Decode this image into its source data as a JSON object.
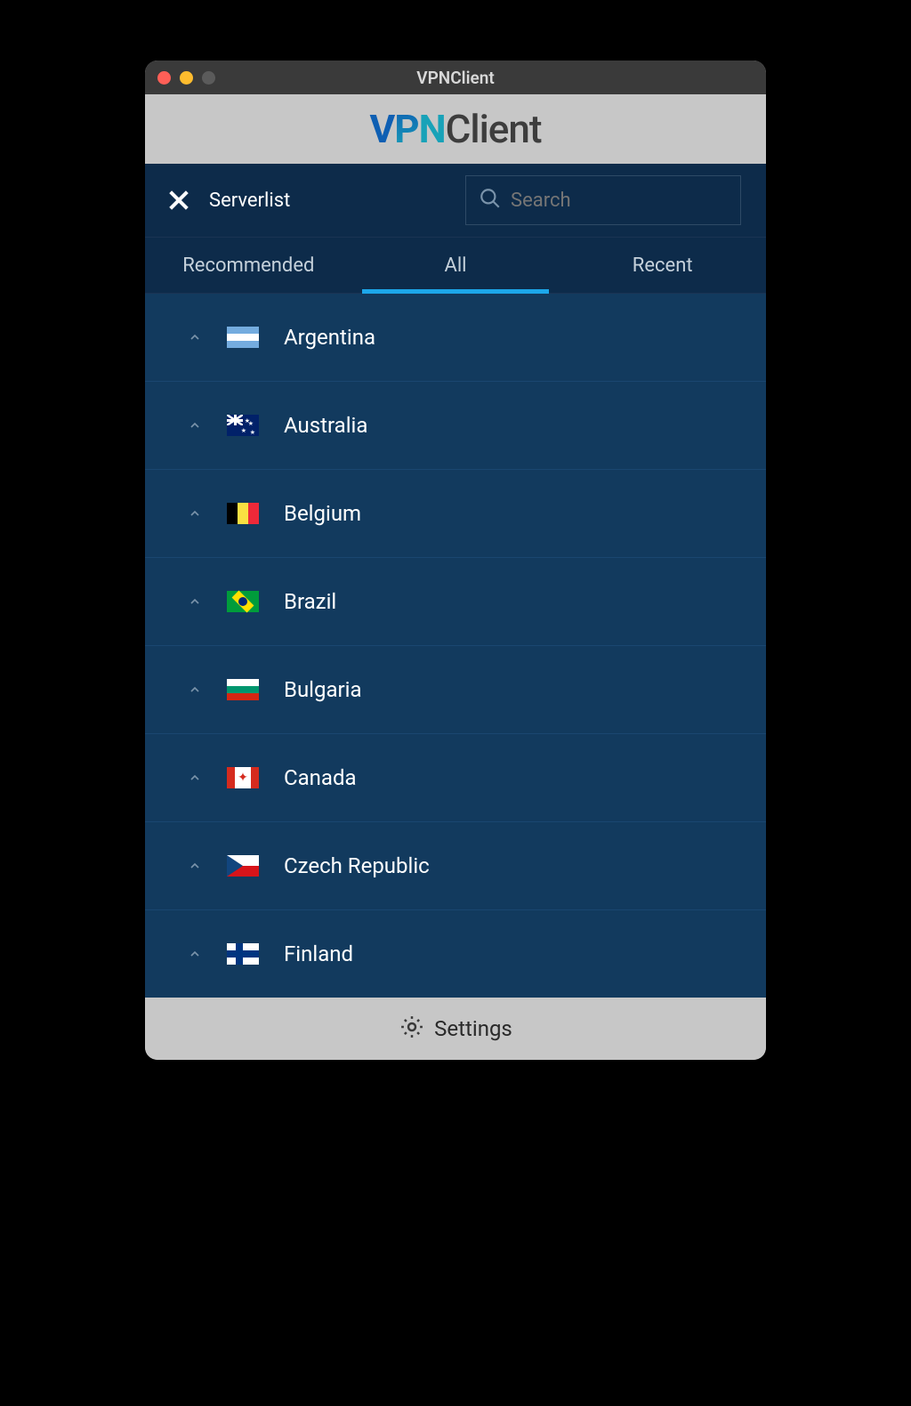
{
  "window": {
    "title": "VPNClient"
  },
  "brand": {
    "v": "V",
    "p": "P",
    "n": "N",
    "client": "Client"
  },
  "topbar": {
    "label": "Serverlist",
    "search_placeholder": "Search"
  },
  "tabs": [
    {
      "label": "Recommended",
      "active": false
    },
    {
      "label": "All",
      "active": true
    },
    {
      "label": "Recent",
      "active": false
    }
  ],
  "servers": [
    {
      "name": "Argentina",
      "flag": "ar"
    },
    {
      "name": "Australia",
      "flag": "au"
    },
    {
      "name": "Belgium",
      "flag": "be"
    },
    {
      "name": "Brazil",
      "flag": "br"
    },
    {
      "name": "Bulgaria",
      "flag": "bg"
    },
    {
      "name": "Canada",
      "flag": "ca"
    },
    {
      "name": "Czech Republic",
      "flag": "cz"
    },
    {
      "name": "Finland",
      "flag": "fi"
    }
  ],
  "footer": {
    "settings_label": "Settings"
  }
}
